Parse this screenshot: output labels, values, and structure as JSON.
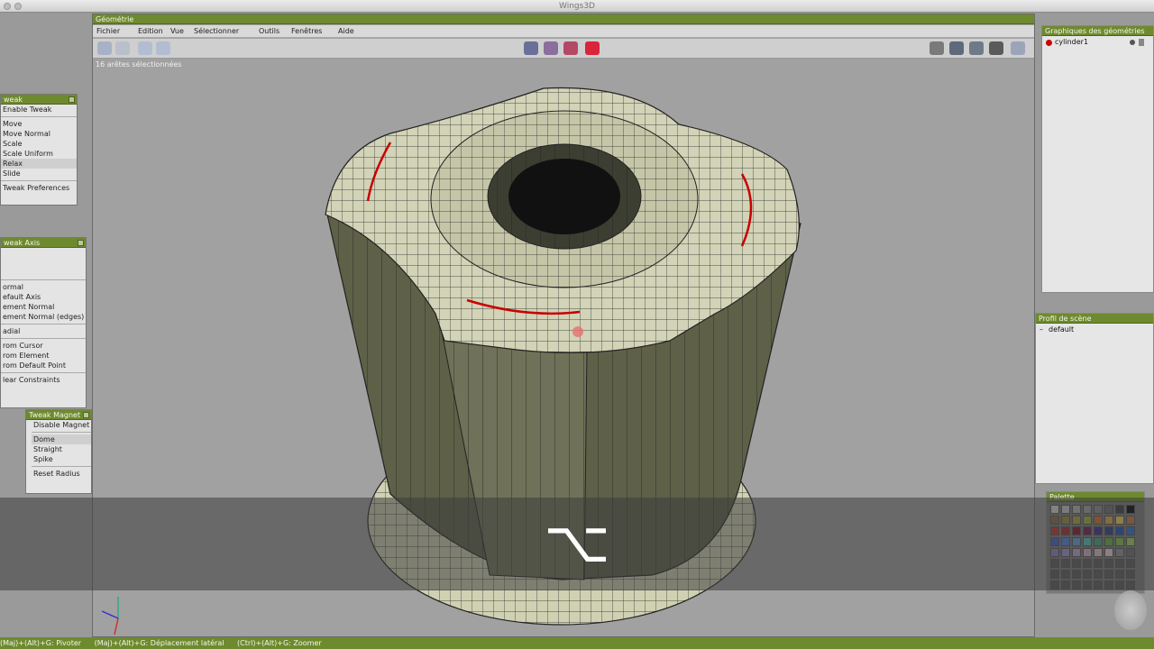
{
  "window": {
    "title": "Wings3D"
  },
  "main": {
    "title": "Géométrie",
    "menu": [
      "Fichier",
      "Edition",
      "Vue",
      "Sélectionner",
      "Outils",
      "Fenêtres",
      "Aide"
    ],
    "info": "16 arêtes sélectionnées"
  },
  "tweak_panel": {
    "title": "weak",
    "items": [
      "Enable Tweak",
      "Move",
      "Move Normal",
      "Scale",
      "Scale Uniform",
      "Relax",
      "Slide",
      "Tweak Preferences"
    ]
  },
  "tweak_axis": {
    "title": "weak Axis",
    "items": [
      "",
      "",
      "",
      "ormal",
      "efault Axis",
      "ement Normal",
      "ement Normal (edges)",
      "adial",
      "rom Cursor",
      "rom Element",
      "rom Default Point",
      "lear Constraints"
    ]
  },
  "tweak_magnet": {
    "title": "Tweak Magnet",
    "items": [
      "Disable Magnet",
      "Dome",
      "Straight",
      "Spike",
      "Reset Radius"
    ]
  },
  "geometry_graph": {
    "title": "Graphiques des géométries",
    "object": "cylinder1"
  },
  "scene_profile": {
    "title": "Profil de scène",
    "item": "default"
  },
  "palette": {
    "title": "Palette",
    "colors": [
      "#d8d8d8",
      "#c8c8c8",
      "#b4b4b4",
      "#a0a0a0",
      "#8c8c8c",
      "#6e6e6e",
      "#3c3c3c",
      "#000000",
      "#8a6a3a",
      "#9a8a3a",
      "#b0a040",
      "#a0b040",
      "#d07030",
      "#e0a050",
      "#f0d060",
      "#c87840",
      "#c03030",
      "#a02828",
      "#801020",
      "#6a1a4a",
      "#3a2a8a",
      "#204080",
      "#2050b0",
      "#3070d0",
      "#4060c0",
      "#5080e0",
      "#60a0e0",
      "#50c0c0",
      "#40a080",
      "#60b040",
      "#80c040",
      "#a0d060",
      "#8a80c0",
      "#a090d0",
      "#c0a0d0",
      "#d0b0c0",
      "#e0c0c0",
      "#f0d0d0",
      "#909090",
      "#707070",
      "#5a5a5a",
      "#5a5a5a",
      "#5a5a5a",
      "#5a5a5a",
      "#5a5a5a",
      "#5a5a5a",
      "#5a5a5a",
      "#5a5a5a",
      "#5a5a5a",
      "#5a5a5a",
      "#5a5a5a",
      "#5a5a5a",
      "#5a5a5a",
      "#5a5a5a",
      "#5a5a5a",
      "#5a5a5a",
      "#5a5a5a",
      "#5a5a5a",
      "#5a5a5a",
      "#5a5a5a",
      "#5a5a5a",
      "#5a5a5a",
      "#5a5a5a",
      "#5a5a5a"
    ]
  },
  "overlay_key": "⌥",
  "status": [
    "(Maj)+(Alt)+G: Pivoter",
    "(Maj)+(Alt)+G: Déplacement latéral",
    "(Ctrl)+(Alt)+G: Zoomer"
  ]
}
